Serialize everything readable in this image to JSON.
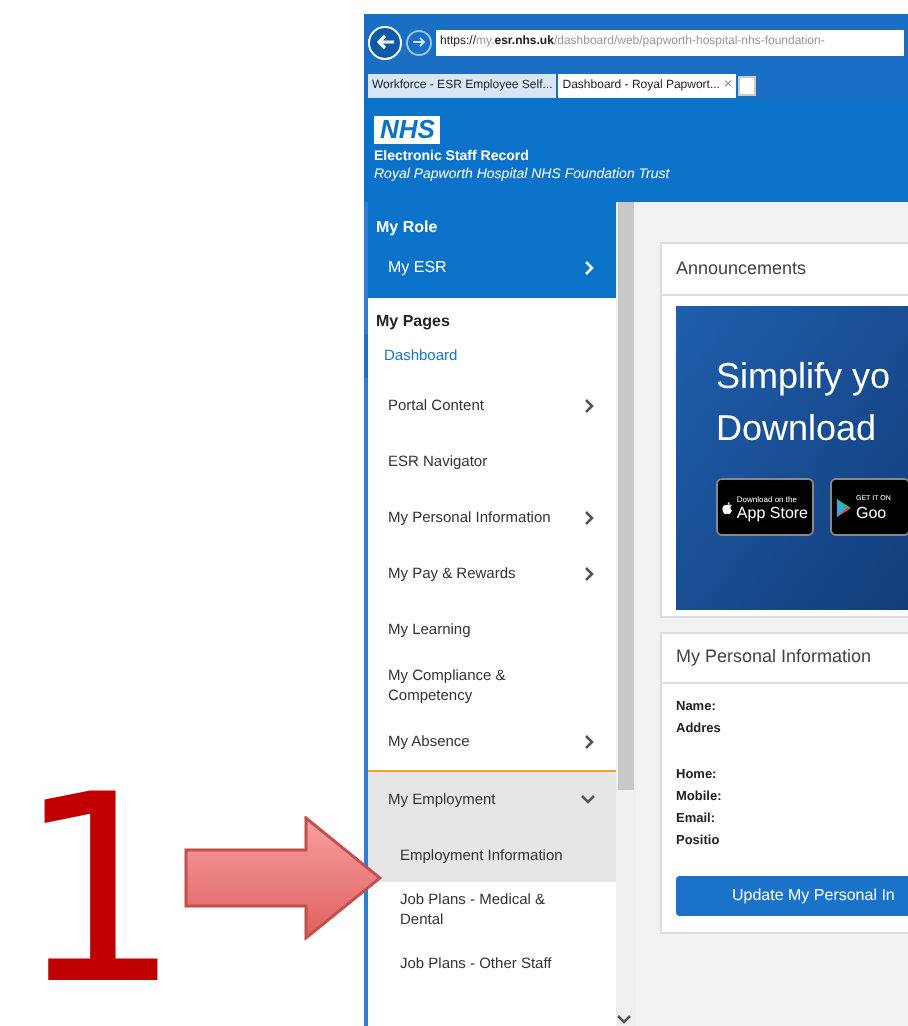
{
  "annotation": {
    "number": "1"
  },
  "browser": {
    "url_scheme": "https://",
    "url_host": "my.esr.nhs.uk",
    "url_path": "/dashboard/web/papworth-hospital-nhs-foundation-",
    "tabs": [
      {
        "label": "Workforce - ESR Employee Self...",
        "selected": false
      },
      {
        "label": "Dashboard - Royal Papwort...",
        "selected": true,
        "close": "×"
      }
    ]
  },
  "header": {
    "logo": "NHS",
    "title": "Electronic Staff Record",
    "subtitle": "Royal Papworth Hospital NHS Foundation Trust"
  },
  "sidebar": {
    "role_heading": "My Role",
    "role_item": "My ESR",
    "pages_heading": "My Pages",
    "items": [
      {
        "label": "Dashboard",
        "selected": true,
        "kind": "link"
      },
      {
        "label": "Portal Content",
        "selected": false,
        "kind": "menu",
        "expanded": false
      },
      {
        "label": "ESR Navigator",
        "selected": false,
        "kind": "link"
      },
      {
        "label": "My Personal Information",
        "selected": false,
        "kind": "menu",
        "expanded": false
      },
      {
        "label": "My Pay & Rewards",
        "selected": false,
        "kind": "menu",
        "expanded": false
      },
      {
        "label": "My Learning",
        "selected": false,
        "kind": "link"
      },
      {
        "label": "My Compliance & Competency",
        "selected": false,
        "kind": "link"
      },
      {
        "label": "My Absence",
        "selected": false,
        "kind": "menu",
        "expanded": false
      },
      {
        "label": "My Employment",
        "selected": false,
        "kind": "menu",
        "expanded": true,
        "children": [
          {
            "label": "Employment Information",
            "selected": true
          },
          {
            "label": "Job Plans - Medical & Dental",
            "selected": false
          },
          {
            "label": "Job Plans - Other Staff",
            "selected": false
          }
        ]
      }
    ]
  },
  "announcements": {
    "title": "Announcements",
    "banner_line_1": "Simplify yo",
    "banner_line_2": "Download",
    "app_store_small": "Download on the",
    "app_store": "App Store",
    "play_small": "GET IT ON",
    "play": "Goo"
  },
  "personal_info": {
    "title": "My Personal Information",
    "fields": [
      "Name:",
      "Addres",
      "Home:",
      "Mobile:",
      "Email:",
      "Positio"
    ],
    "button": "Update My Personal In"
  }
}
